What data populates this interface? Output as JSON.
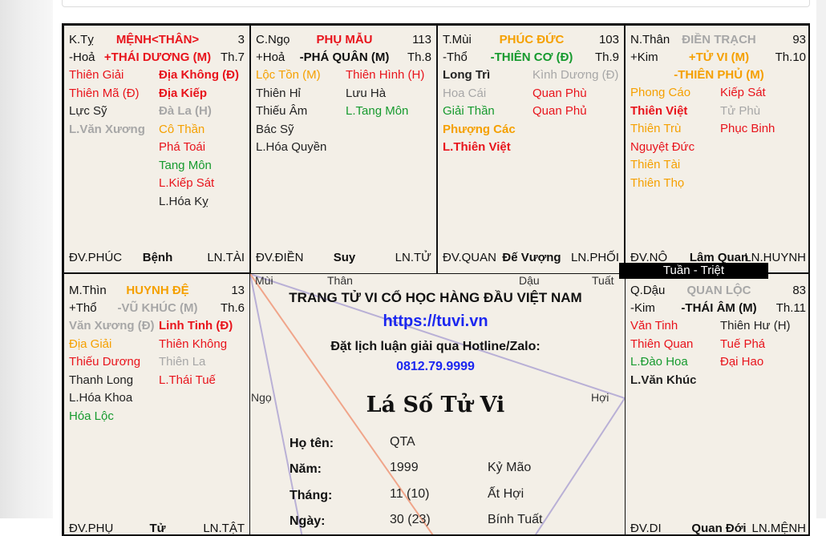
{
  "colors": {
    "red": "#e8141c",
    "orange": "#f5a000",
    "green": "#169a2e",
    "gray": "#a7a7a7",
    "blue": "#1b27f0",
    "background": "#f3efe7"
  },
  "cells": [
    {
      "id": "ty",
      "name": "K.Tỵ",
      "palace": "MỆNH<THÂN>",
      "num": "3",
      "hoa": "-Hoả",
      "main_star": "+THÁI DƯƠNG (M)",
      "th": "Th.7",
      "left": [
        [
          "Thiên Giải",
          "red",
          ""
        ],
        [
          "Thiên Mã (Đ)",
          "red",
          ""
        ],
        [
          "Lực Sỹ",
          "black",
          ""
        ],
        [
          "L.Văn Xương",
          "gray",
          "b"
        ]
      ],
      "right": [
        [
          "Địa Không (Đ)",
          "red",
          "b"
        ],
        [
          "Địa Kiếp",
          "red",
          "b"
        ],
        [
          "Đà La (H)",
          "gray",
          "b"
        ],
        [
          "Cô Thần",
          "orange",
          ""
        ],
        [
          "Phá Toái",
          "red",
          ""
        ],
        [
          "Tang Môn",
          "green",
          ""
        ],
        [
          "L.Kiếp Sát",
          "red",
          ""
        ],
        [
          "L.Hóa Kỵ",
          "black",
          ""
        ]
      ],
      "dv": "ĐV.PHÚC",
      "stage": "Bệnh",
      "ln": "LN.TÀI"
    },
    {
      "id": "ngo",
      "name": "C.Ngọ",
      "palace": "PHỤ MẪU",
      "num": "113",
      "hoa": "+Hoả",
      "main_star": "-PHÁ QUÂN (M)",
      "th": "Th.8",
      "left": [
        [
          "Lộc Tồn (M)",
          "orange",
          ""
        ],
        [
          "Thiên Hỉ",
          "black",
          ""
        ],
        [
          "Thiếu Âm",
          "black",
          ""
        ],
        [
          "Bác Sỹ",
          "black",
          ""
        ],
        [
          "L.Hóa Quyền",
          "black",
          ""
        ]
      ],
      "right": [
        [
          "Thiên Hình (H)",
          "red",
          ""
        ],
        [
          "Lưu Hà",
          "black",
          ""
        ],
        [
          "L.Tang Môn",
          "green",
          ""
        ]
      ],
      "dv": "ĐV.ĐIỀN",
      "stage": "Suy",
      "ln": "LN.TỬ"
    },
    {
      "id": "mui",
      "name": "T.Mùi",
      "palace": "PHÚC ĐỨC",
      "num": "103",
      "hoa": "-Thổ",
      "main_star": "-THIÊN CƠ (Đ)",
      "th": "Th.9",
      "left": [
        [
          "Long Trì",
          "black",
          "b"
        ],
        [
          "Hoa Cái",
          "gray",
          ""
        ],
        [
          "Giải Thần",
          "green",
          ""
        ],
        [
          "Phượng Các",
          "orange",
          "b"
        ],
        [
          "L.Thiên Việt",
          "red",
          "b"
        ]
      ],
      "right": [
        [
          "Kình Dương (Đ)",
          "gray",
          ""
        ],
        [
          "Quan Phù",
          "red",
          ""
        ],
        [
          "Quan Phủ",
          "red",
          ""
        ]
      ],
      "dv": "ĐV.QUAN",
      "stage": "Đế Vượng",
      "ln": "LN.PHỐI"
    },
    {
      "id": "than",
      "name": "N.Thân",
      "palace": "ĐIỀN TRẠCH",
      "num": "93",
      "hoa": "+Kim",
      "main_star": "+TỬ VI (M)",
      "main_star2": "-THIÊN PHỦ (M)",
      "th": "Th.10",
      "left": [
        [
          "Phong Cáo",
          "orange",
          ""
        ],
        [
          "Thiên Việt",
          "red",
          "b"
        ],
        [
          "Thiên Trù",
          "orange",
          ""
        ],
        [
          "Nguyệt Đức",
          "red",
          ""
        ],
        [
          "Thiên Tài",
          "orange",
          ""
        ],
        [
          "Thiên Thọ",
          "orange",
          ""
        ]
      ],
      "right": [
        [
          "Kiếp Sát",
          "red",
          ""
        ],
        [
          "Tử Phù",
          "gray",
          ""
        ],
        [
          "Phục Binh",
          "red",
          ""
        ]
      ],
      "dv": "ĐV.NÔ",
      "stage": "Lâm Quan",
      "ln": "LN.HUYNH"
    },
    {
      "id": "thin",
      "name": "M.Thìn",
      "palace": "HUYNH ĐỆ",
      "num": "13",
      "hoa": "+Thổ",
      "main_star": "-VŨ KHÚC (M)",
      "th": "Th.6",
      "left": [
        [
          "Văn Xương (Đ)",
          "gray",
          "b"
        ],
        [
          "Địa Giải",
          "orange",
          ""
        ],
        [
          "Thiếu Dương",
          "red",
          ""
        ],
        [
          "Thanh Long",
          "black",
          ""
        ],
        [
          "L.Hóa Khoa",
          "black",
          ""
        ],
        [
          "Hóa Lộc",
          "green",
          ""
        ]
      ],
      "right": [
        [
          "Linh Tinh (Đ)",
          "red",
          "b"
        ],
        [
          "Thiên Không",
          "red",
          ""
        ],
        [
          "Thiên La",
          "gray",
          ""
        ],
        [
          "L.Thái Tuế",
          "red",
          ""
        ]
      ],
      "dv": "ĐV.PHỤ",
      "stage": "Tử",
      "ln": "LN.TẬT"
    },
    {
      "id": "dau",
      "name": "Q.Dậu",
      "palace": "QUAN LỘC",
      "num": "83",
      "hoa": "-Kim",
      "main_star": "-THÁI ÂM (M)",
      "th": "Th.11",
      "left": [
        [
          "Văn Tinh",
          "red",
          ""
        ],
        [
          "Thiên Quan",
          "red",
          ""
        ],
        [
          "L.Đào Hoa",
          "green",
          ""
        ],
        [
          "L.Văn Khúc",
          "black",
          "b"
        ]
      ],
      "right": [
        [
          "Thiên Hư (H)",
          "black",
          ""
        ],
        [
          "Tuế Phá",
          "red",
          ""
        ],
        [
          "Đại Hao",
          "red",
          ""
        ]
      ],
      "dv": "ĐV.DI",
      "stage": "Quan Đới",
      "ln": "LN.MỆNH"
    }
  ],
  "center": {
    "title": "TRANG TỬ VI CỔ HỌC HÀNG ĐẦU VIỆT NAM",
    "url": "https://tuvi.vn",
    "booking": "Đặt lịch luận giải qua Hotline/Zalo:",
    "phone": "0812.79.9999",
    "heading": "Lá Số Tử Vi",
    "fields": [
      {
        "label": "Họ tên:",
        "value": "QTA",
        "extra": ""
      },
      {
        "label": "Năm:",
        "value": "1999",
        "extra": "Kỷ Mão"
      },
      {
        "label": "Tháng:",
        "value": "11 (10)",
        "extra": "Ất Hợi"
      },
      {
        "label": "Ngày:",
        "value": "30 (23)",
        "extra": "Bính Tuất"
      }
    ],
    "dirs": {
      "mui": "Mùi",
      "than": "Thân",
      "dau": "Dậu",
      "tuat": "Tuất",
      "ngo": "Ngọ",
      "hoi": "Hợi"
    }
  },
  "tuan_triet": "Tuần - Triệt"
}
